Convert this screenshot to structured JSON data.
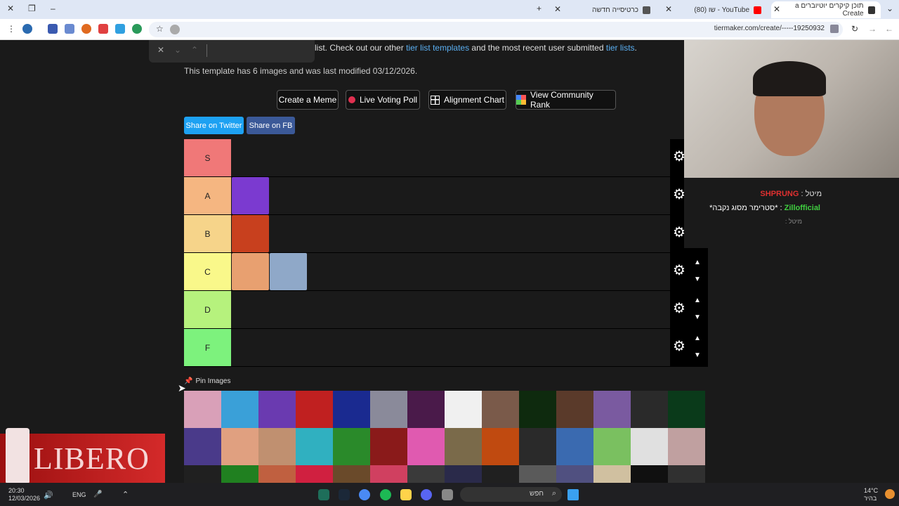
{
  "browser": {
    "tabs": [
      {
        "title": "תוכן קיקרים יוטיוברים a Create",
        "active": true,
        "favicon_color": "#333333"
      },
      {
        "title": "YouTube - שו (80)",
        "active": false,
        "favicon_color": "#ff0000"
      },
      {
        "title": "כרטיסייה חדשה",
        "active": false,
        "favicon_color": "#555555"
      }
    ],
    "url": "tiermaker.com/create/-----19250932"
  },
  "page": {
    "intro_prefix": "list. Check out our other ",
    "intro_link1": "tier list templates",
    "intro_middle": " and the most recent user submitted ",
    "intro_link2": "tier lists",
    "intro_suffix": ".",
    "modified": "This template has 6 images and was last modified 03/12/2026.",
    "buttons": {
      "meme": "Create a Meme",
      "poll": "Live Voting Poll",
      "alignment": "Alignment Chart",
      "community": "View Community Rank"
    },
    "share_twitter": "Share on Twitter",
    "share_fb": "Share on FB",
    "pin_images": "Pin Images"
  },
  "tiers": [
    {
      "label": "S",
      "color": "#f07878",
      "items": []
    },
    {
      "label": "A",
      "color": "#f5b681",
      "items": [
        "#7b3ad0"
      ]
    },
    {
      "label": "B",
      "color": "#f6d48a",
      "items": [
        "#c8401e"
      ]
    },
    {
      "label": "C",
      "color": "#f9f88a",
      "items": [
        "#e8a070",
        "#8fa8c8"
      ]
    },
    {
      "label": "D",
      "color": "#b6f27d",
      "items": []
    },
    {
      "label": "F",
      "color": "#7df27d",
      "items": []
    }
  ],
  "pool_colors": [
    "#d9a0b8",
    "#3aa0d8",
    "#6a3ab0",
    "#c02020",
    "#1a2a90",
    "#8a8a9a",
    "#4a1a4a",
    "#f0f0f0",
    "#7a5a4a",
    "#0e2a0e",
    "#5a3a2a",
    "#7a5aa0",
    "#2a2a2a",
    "#0a3a1a",
    "#4a3a8a",
    "#e0a080",
    "#c09070",
    "#30b0c0",
    "#2a8a2a",
    "#8a1a1a",
    "#e05ab0",
    "#7a6a4a",
    "#c04a10",
    "#2a2a2a",
    "#3a6ab0",
    "#7ac060",
    "#e0e0e0",
    "#c0a0a0",
    "#202020",
    "#208020",
    "#c06040",
    "#d02040",
    "#6a4a2a",
    "#d04060",
    "#3a3a3a",
    "#2a2a4a",
    "#202020",
    "#5a5a5a",
    "#505080",
    "#d0c0a0",
    "#101010",
    "#303030"
  ],
  "stream": {
    "chat": [
      {
        "user": "SHPRUNG",
        "prefix": "מיטל : ",
        "color": "#e03030"
      },
      {
        "user": "Zillofficial",
        "text": ": *סטרימר מסוג נקבה*",
        "color": "#40d040"
      },
      {
        "user": "",
        "text": "מיטל :",
        "color": "#888888"
      }
    ]
  },
  "ad": {
    "brand": "LIBERO"
  },
  "taskbar": {
    "time": "20:30",
    "date": "12/03/2026",
    "lang": "ENG",
    "search_placeholder": "חפש",
    "weather": "14°C",
    "weather_sub": "בהיר"
  }
}
